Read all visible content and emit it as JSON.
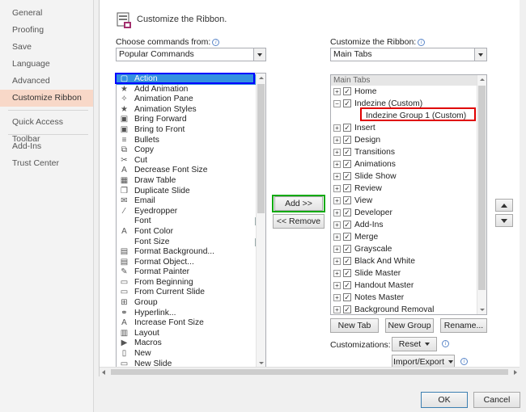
{
  "nav": {
    "items": [
      {
        "label": "General",
        "active": false
      },
      {
        "label": "Proofing",
        "active": false
      },
      {
        "label": "Save",
        "active": false
      },
      {
        "label": "Language",
        "active": false
      },
      {
        "label": "Advanced",
        "active": false
      },
      {
        "label": "Customize Ribbon",
        "active": true
      },
      {
        "label": "Quick Access Toolbar",
        "active": false
      },
      {
        "label": "Add-Ins",
        "active": false
      },
      {
        "label": "Trust Center",
        "active": false
      }
    ]
  },
  "header": {
    "title": "Customize the Ribbon."
  },
  "left": {
    "label": "Choose commands from:",
    "combo_value": "Popular Commands",
    "commands": [
      {
        "label": "Action",
        "icon": "action-icon",
        "glyph": "▢",
        "submenu": false
      },
      {
        "label": "Add Animation",
        "icon": "add-animation-icon",
        "glyph": "★",
        "submenu": true
      },
      {
        "label": "Animation Pane",
        "icon": "animation-pane-icon",
        "glyph": "✧",
        "submenu": false
      },
      {
        "label": "Animation Styles",
        "icon": "animation-styles-icon",
        "glyph": "★",
        "submenu": true
      },
      {
        "label": "Bring Forward",
        "icon": "bring-forward-icon",
        "glyph": "▣",
        "submenu": false
      },
      {
        "label": "Bring to Front",
        "icon": "bring-to-front-icon",
        "glyph": "▣",
        "submenu": false
      },
      {
        "label": "Bullets",
        "icon": "bullets-icon",
        "glyph": "≡",
        "submenu": true
      },
      {
        "label": "Copy",
        "icon": "copy-icon",
        "glyph": "⧉",
        "submenu": false
      },
      {
        "label": "Cut",
        "icon": "cut-icon",
        "glyph": "✂",
        "submenu": false
      },
      {
        "label": "Decrease Font Size",
        "icon": "decrease-font-size-icon",
        "glyph": "A",
        "submenu": false
      },
      {
        "label": "Draw Table",
        "icon": "draw-table-icon",
        "glyph": "▦",
        "submenu": false
      },
      {
        "label": "Duplicate Slide",
        "icon": "duplicate-slide-icon",
        "glyph": "❐",
        "submenu": false
      },
      {
        "label": "Email",
        "icon": "email-icon",
        "glyph": "✉",
        "submenu": false
      },
      {
        "label": "Eyedropper",
        "icon": "eyedropper-icon",
        "glyph": "⁄",
        "submenu": false
      },
      {
        "label": "Font",
        "icon": "font-icon",
        "glyph": "",
        "submenu": false,
        "picker": true
      },
      {
        "label": "Font Color",
        "icon": "font-color-icon",
        "glyph": "A",
        "submenu": true
      },
      {
        "label": "Font Size",
        "icon": "font-size-icon",
        "glyph": "",
        "submenu": false,
        "picker": true
      },
      {
        "label": "Format Background...",
        "icon": "format-background-icon",
        "glyph": "▤",
        "submenu": false
      },
      {
        "label": "Format Object...",
        "icon": "format-object-icon",
        "glyph": "▤",
        "submenu": false
      },
      {
        "label": "Format Painter",
        "icon": "format-painter-icon",
        "glyph": "✎",
        "submenu": false
      },
      {
        "label": "From Beginning",
        "icon": "from-beginning-icon",
        "glyph": "▭",
        "submenu": false
      },
      {
        "label": "From Current Slide",
        "icon": "from-current-slide-icon",
        "glyph": "▭",
        "submenu": false
      },
      {
        "label": "Group",
        "icon": "group-icon",
        "glyph": "⊞",
        "submenu": false
      },
      {
        "label": "Hyperlink...",
        "icon": "hyperlink-icon",
        "glyph": "⚭",
        "submenu": false
      },
      {
        "label": "Increase Font Size",
        "icon": "increase-font-size-icon",
        "glyph": "A",
        "submenu": false
      },
      {
        "label": "Layout",
        "icon": "layout-icon",
        "glyph": "▥",
        "submenu": true
      },
      {
        "label": "Macros",
        "icon": "macros-icon",
        "glyph": "▶",
        "submenu": false
      },
      {
        "label": "New",
        "icon": "new-icon",
        "glyph": "▯",
        "submenu": false
      },
      {
        "label": "New Slide",
        "icon": "new-slide-icon",
        "glyph": "▭",
        "submenu": true
      }
    ]
  },
  "middle": {
    "add_label": "Add >>",
    "remove_label": "<< Remove"
  },
  "right": {
    "label": "Customize the Ribbon:",
    "combo_value": "Main Tabs",
    "tree_header": "Main Tabs",
    "tabs": [
      {
        "label": "Home",
        "expander": "+",
        "level": 1
      },
      {
        "label": "Indezine (Custom)",
        "expander": "−",
        "level": 1
      },
      {
        "label": "Indezine Group 1 (Custom)",
        "expander": "",
        "level": 2
      },
      {
        "label": "Insert",
        "expander": "+",
        "level": 1
      },
      {
        "label": "Design",
        "expander": "+",
        "level": 1
      },
      {
        "label": "Transitions",
        "expander": "+",
        "level": 1
      },
      {
        "label": "Animations",
        "expander": "+",
        "level": 1
      },
      {
        "label": "Slide Show",
        "expander": "+",
        "level": 1
      },
      {
        "label": "Review",
        "expander": "+",
        "level": 1
      },
      {
        "label": "View",
        "expander": "+",
        "level": 1
      },
      {
        "label": "Developer",
        "expander": "+",
        "level": 1
      },
      {
        "label": "Add-Ins",
        "expander": "+",
        "level": 1
      },
      {
        "label": "Merge",
        "expander": "+",
        "level": 1
      },
      {
        "label": "Grayscale",
        "expander": "+",
        "level": 1
      },
      {
        "label": "Black And White",
        "expander": "+",
        "level": 1
      },
      {
        "label": "Slide Master",
        "expander": "+",
        "level": 1
      },
      {
        "label": "Handout Master",
        "expander": "+",
        "level": 1
      },
      {
        "label": "Notes Master",
        "expander": "+",
        "level": 1
      },
      {
        "label": "Background Removal",
        "expander": "+",
        "level": 1
      }
    ],
    "new_tab": "New Tab",
    "new_group": "New Group",
    "rename": "Rename...",
    "customizations_label": "Customizations:",
    "reset": "Reset",
    "import_export": "Import/Export"
  },
  "footer": {
    "ok": "OK",
    "cancel": "Cancel"
  },
  "colors": {
    "highlight_blue": "#0000ff",
    "highlight_red": "#e00000",
    "highlight_green": "#11aa11",
    "selected_row": "#3391e0",
    "nav_active": "#f8d8c8"
  }
}
